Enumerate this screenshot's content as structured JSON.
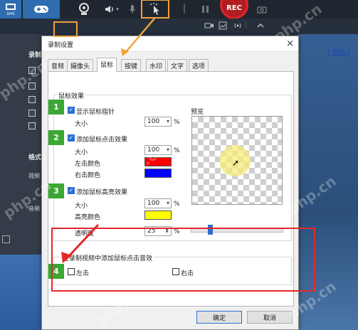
{
  "toolbar": {
    "screen_label": "omi",
    "record_label": "REC"
  },
  "background": {
    "section_record": "录制",
    "section_format": "格式",
    "video_label": "视频",
    "audio_label": "音频"
  },
  "dialog": {
    "title": "录制设置",
    "close": "×",
    "tabs": [
      {
        "label": "音频"
      },
      {
        "label": "摄像头"
      },
      {
        "label": "鼠标"
      },
      {
        "label": "按键"
      },
      {
        "label": "水印"
      },
      {
        "label": "文字"
      },
      {
        "label": "选项"
      }
    ],
    "active_tab": "鼠标",
    "help_link": "[ 帮助 ]",
    "mouse_group_title": "鼠标效果",
    "preview_label": "预览",
    "show_pointer": {
      "label": "显示鼠标指针",
      "checked": true,
      "size_label": "大小",
      "size_value": "100",
      "unit": "%"
    },
    "click_effect": {
      "label": "添加鼠标点击效果",
      "checked": true,
      "size_label": "大小",
      "size_value": "100",
      "unit": "%",
      "left_color_label": "左击颜色",
      "left_color": "#ff0000",
      "right_color_label": "右击颜色",
      "right_color": "#0000ff"
    },
    "highlight": {
      "label": "添加鼠标高亮效果",
      "checked": true,
      "size_label": "大小",
      "size_value": "100",
      "unit": "%",
      "color_label": "高亮颜色",
      "color": "#ffff00",
      "opacity_label": "透明度",
      "opacity_value": "25",
      "opacity_unit": "%"
    },
    "sound_group_title": "在录制视频中添加鼠标点击音效",
    "sound_left": {
      "label": "左击",
      "checked": false
    },
    "sound_right": {
      "label": "右击",
      "checked": false
    },
    "ok_button": "确定",
    "cancel_button": "取消"
  },
  "steps": [
    "1",
    "2",
    "3",
    "4"
  ],
  "watermark": "php.cn",
  "colors": {
    "annotation_red": "#e3282b",
    "annotation_orange": "#f0a13a",
    "step_green": "#3aa832"
  }
}
